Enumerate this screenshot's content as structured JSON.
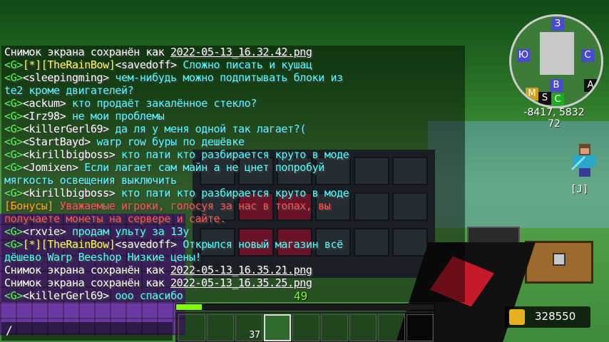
{
  "chat": {
    "lines": [
      {
        "pre": "Снимок экрана сохранён как ",
        "link": "2022-05-13_16.32.42.png"
      },
      {
        "tag": "<G>",
        "rank": "[*][TheRainBow]",
        "name": "<savedoff>",
        "msg": "Сложно писать и кушац"
      },
      {
        "tag": "<G>",
        "name": "<sleepingming>",
        "msg": "чем-нибудь можно подпитывать блоки из"
      },
      {
        "msg": "te2 кроме двигателей?"
      },
      {
        "tag": "<G>",
        "name": "<ackum>",
        "msg": "кто продаёт закалённое стекло?"
      },
      {
        "tag": "<G>",
        "name": "<Irz98>",
        "msg": "не мои проблемы"
      },
      {
        "tag": "<G>",
        "name": "<killerGerl69>",
        "msg": "да ля у меня одной так лагает?("
      },
      {
        "tag": "<G>",
        "name": "<StartBayd>",
        "msg": "warp row буры по дешёвке"
      },
      {
        "tag": "<G>",
        "name": "<kirillbigboss>",
        "msg": "кто пати кто разбирается круто в моде"
      },
      {
        "tag": "<G>",
        "name": "<Jomixen>",
        "msg": "Если лагает сам майн а не цнет попробуй"
      },
      {
        "msg": " мягкость освещения выключить"
      },
      {
        "tag": "<G>",
        "name": "<kirillbigboss>",
        "msg": "кто пати кто разбирается круто в моде"
      },
      {
        "bonus": "[Бонусы]",
        "msg": "Уважаемые игроки, голосуя за нас в топах, вы"
      },
      {
        "msg": " получаете монеты на сервере и сайте."
      },
      {
        "tag": "<G>",
        "name": "<rxvie>",
        "msg": "продам ульту за 13у"
      },
      {
        "tag": "<G>",
        "rank": "[*][TheRainBow]",
        "name": "<savedoff>",
        "msg": "Открылся новый магазин всё"
      },
      {
        "msg": "дёшево Warp Beeshop Низкие цены!"
      },
      {
        "pre": "Снимок экрана сохранён как ",
        "link": "2022-05-13_16.35.21.png"
      },
      {
        "pre": "Снимок экрана сохранён как ",
        "link": "2022-05-13_16.35.25.png"
      },
      {
        "tag": "<G>",
        "name": "<killerGerl69>",
        "msg": "ооо спасибо"
      }
    ]
  },
  "chat_input": {
    "text": "/"
  },
  "minimap": {
    "letters": [
      "З",
      "Ю",
      "С",
      "В",
      "М",
      "S",
      "C",
      "A"
    ],
    "coords": "-8417, 5832",
    "height": "72"
  },
  "player": {
    "key_label": "[J]"
  },
  "hotbar": {
    "slot_count": "37",
    "xp_level": "49",
    "xp_progress": 0.1
  },
  "money": {
    "value": "328550"
  }
}
